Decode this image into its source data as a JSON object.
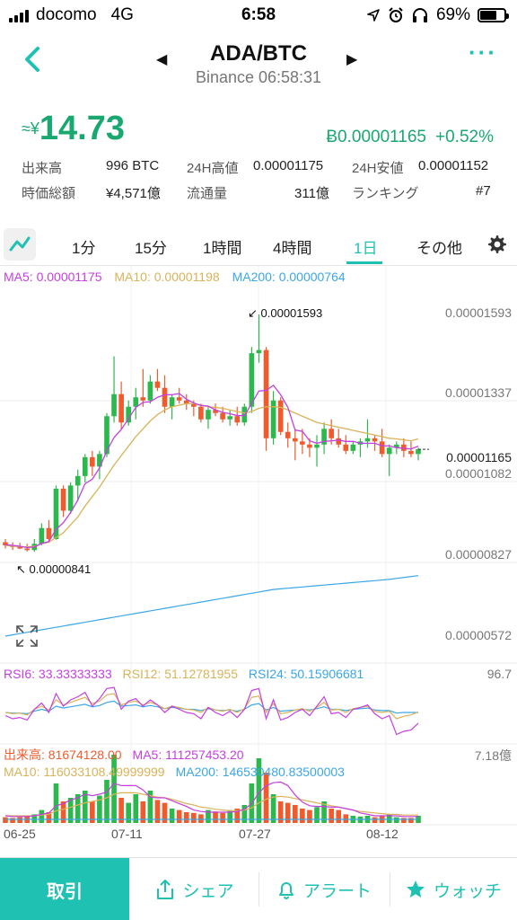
{
  "status_bar": {
    "carrier": "docomo",
    "network": "4G",
    "time": "6:58",
    "battery": "69%",
    "battery_level": 0.69
  },
  "header": {
    "title": "ADA/BTC",
    "subtitle": "Binance 06:58:31"
  },
  "price": {
    "prefix": "≈¥",
    "value": "14.73",
    "btc_value": "Ƀ0.00001165",
    "change": "+0.52%"
  },
  "stats": [
    {
      "label": "出来高",
      "value": "996 BTC"
    },
    {
      "label": "24H高値",
      "value": "0.00001175"
    },
    {
      "label": "24H安値",
      "value": "0.00001152"
    },
    {
      "label": "時価総額",
      "value": "¥4,571億"
    },
    {
      "label": "流通量",
      "value": "311億"
    },
    {
      "label": "ランキング",
      "value": "#7"
    }
  ],
  "tabs": [
    "1分",
    "15分",
    "1時間",
    "4時間",
    "1日",
    "その他"
  ],
  "active_tab": "1日",
  "colors": {
    "accent": "#1fc1b3",
    "up": "#1aa871",
    "candle_up": "#2db84d",
    "candle_down": "#ef5b2d",
    "ma5": "#c53fe0",
    "ma10": "#d9b35a",
    "ma200": "#3ba7e6"
  },
  "indicators": {
    "ma5": "MA5: 0.00001175",
    "ma10": "MA10: 0.00001198",
    "ma200": "MA200: 0.00000764",
    "rsi6": "RSI6: 33.33333333",
    "rsi12": "RSI12: 51.12781955",
    "rsi24": "RSI24: 50.15906681",
    "rsi_max": "96.7",
    "vol": "出来高: 81674128.00",
    "vol_ma5": "MA5: 111257453.20",
    "vol_ma10": "MA10: 116033108.49999999",
    "vol_ma200": "MA200: 146530480.83500003",
    "vol_max": "7.18億"
  },
  "chart_data": {
    "type": "candlestick",
    "y_ticks": [
      "0.00001593",
      "0.00001337",
      "0.00001082",
      "0.00000827",
      "0.00000572"
    ],
    "current_price": "0.00001165",
    "annotations": {
      "high": "0.00001593",
      "low": "0.00000841"
    },
    "x_ticks": [
      "06-25",
      "07-11",
      "07-27",
      "08-12"
    ],
    "ohlc": [
      [
        8.7e-06,
        8.8e-06,
        8.5e-06,
        8.6e-06
      ],
      [
        8.6e-06,
        8.7e-06,
        8.45e-06,
        8.55e-06
      ],
      [
        8.55e-06,
        8.68e-06,
        8.48e-06,
        8.5e-06
      ],
      [
        8.5e-06,
        8.65e-06,
        8.41e-06,
        8.45e-06
      ],
      [
        8.45e-06,
        8.8e-06,
        8.4e-06,
        8.65e-06
      ],
      [
        8.65e-06,
        9.3e-06,
        8.6e-06,
        9.15e-06
      ],
      [
        9.15e-06,
        9.4e-06,
        8.7e-06,
        8.8e-06
      ],
      [
        8.8e-06,
        1.05e-05,
        8.78e-06,
        1.04e-05
      ],
      [
        1.04e-05,
        1.05e-05,
        9.5e-06,
        9.7e-06
      ],
      [
        9.7e-06,
        1.06e-05,
        9.6e-06,
        1.05e-05
      ],
      [
        1.05e-05,
        1.1e-05,
        1e-05,
        1.08e-05
      ],
      [
        1.08e-05,
        1.15e-05,
        1.06e-05,
        1.14e-05
      ],
      [
        1.14e-05,
        1.16e-05,
        1.08e-05,
        1.11e-05
      ],
      [
        1.11e-05,
        1.16e-05,
        1.07e-05,
        1.15e-05
      ],
      [
        1.15e-05,
        1.28e-05,
        1.14e-05,
        1.27e-05
      ],
      [
        1.27e-05,
        1.46e-05,
        1.25e-05,
        1.34e-05
      ],
      [
        1.34e-05,
        1.38e-05,
        1.23e-05,
        1.25e-05
      ],
      [
        1.25e-05,
        1.32e-05,
        1.24e-05,
        1.3e-05
      ],
      [
        1.3e-05,
        1.36e-05,
        1.26e-05,
        1.33e-05
      ],
      [
        1.33e-05,
        1.42e-05,
        1.3e-05,
        1.32e-05
      ],
      [
        1.32e-05,
        1.4e-05,
        1.31e-05,
        1.38e-05
      ],
      [
        1.38e-05,
        1.42e-05,
        1.35e-05,
        1.36e-05
      ],
      [
        1.36e-05,
        1.4e-05,
        1.28e-05,
        1.3e-05
      ],
      [
        1.3e-05,
        1.34e-05,
        1.26e-05,
        1.33e-05
      ],
      [
        1.33e-05,
        1.36e-05,
        1.31e-05,
        1.32e-05
      ],
      [
        1.32e-05,
        1.34e-05,
        1.29e-05,
        1.31e-05
      ],
      [
        1.31e-05,
        1.32e-05,
        1.27e-05,
        1.3e-05
      ],
      [
        1.3e-05,
        1.31e-05,
        1.25e-05,
        1.26e-05
      ],
      [
        1.26e-05,
        1.3e-05,
        1.23e-05,
        1.29e-05
      ],
      [
        1.29e-05,
        1.31e-05,
        1.27e-05,
        1.28e-05
      ],
      [
        1.28e-05,
        1.3e-05,
        1.25e-05,
        1.26e-05
      ],
      [
        1.26e-05,
        1.29e-05,
        1.24e-05,
        1.27e-05
      ],
      [
        1.27e-05,
        1.3e-05,
        1.24e-05,
        1.25e-05
      ],
      [
        1.25e-05,
        1.31e-05,
        1.24e-05,
        1.3e-05
      ],
      [
        1.3e-05,
        1.49e-05,
        1.28e-05,
        1.47e-05
      ],
      [
        1.47e-05,
        1.593e-05,
        1.44e-05,
        1.48e-05
      ],
      [
        1.48e-05,
        1.49e-05,
        1.16e-05,
        1.2e-05
      ],
      [
        1.2e-05,
        1.35e-05,
        1.18e-05,
        1.32e-05
      ],
      [
        1.32e-05,
        1.33e-05,
        1.21e-05,
        1.22e-05
      ],
      [
        1.22e-05,
        1.25e-05,
        1.17e-05,
        1.2e-05
      ],
      [
        1.2e-05,
        1.23e-05,
        1.13e-05,
        1.19e-05
      ],
      [
        1.19e-05,
        1.23e-05,
        1.15e-05,
        1.18e-05
      ],
      [
        1.18e-05,
        1.2e-05,
        1.14e-05,
        1.17e-05
      ],
      [
        1.17e-05,
        1.21e-05,
        1.11e-05,
        1.18e-05
      ],
      [
        1.18e-05,
        1.25e-05,
        1.15e-05,
        1.23e-05
      ],
      [
        1.23e-05,
        1.26e-05,
        1.18e-05,
        1.2e-05
      ],
      [
        1.2e-05,
        1.23e-05,
        1.17e-05,
        1.18e-05
      ],
      [
        1.18e-05,
        1.21e-05,
        1.15e-05,
        1.16e-05
      ],
      [
        1.16e-05,
        1.19e-05,
        1.15e-05,
        1.18e-05
      ],
      [
        1.18e-05,
        1.2e-05,
        1.14e-05,
        1.19e-05
      ],
      [
        1.19e-05,
        1.26e-05,
        1.17e-05,
        1.2e-05
      ],
      [
        1.2e-05,
        1.21e-05,
        1.16e-05,
        1.19e-05
      ],
      [
        1.19e-05,
        1.23e-05,
        1.14e-05,
        1.15e-05
      ],
      [
        1.15e-05,
        1.18e-05,
        1.08e-05,
        1.17e-05
      ],
      [
        1.17e-05,
        1.19e-05,
        1.15e-05,
        1.18e-05
      ],
      [
        1.18e-05,
        1.2e-05,
        1.14e-05,
        1.16e-05
      ],
      [
        1.16e-05,
        1.19e-05,
        1.14e-05,
        1.15e-05
      ],
      [
        1.15e-05,
        1.17e-05,
        1.13e-05,
        1.165e-05
      ]
    ],
    "ma10": [
      8.6e-06,
      8.58e-06,
      8.56e-06,
      8.55e-06,
      8.57e-06,
      8.65e-06,
      8.7e-06,
      8.85e-06,
      9e-06,
      9.25e-06,
      9.5e-06,
      9.85e-06,
      1.015e-05,
      1.045e-05,
      1.08e-05,
      1.115e-05,
      1.145e-05,
      1.175e-05,
      1.205e-05,
      1.23e-05,
      1.255e-05,
      1.275e-05,
      1.29e-05,
      1.3e-05,
      1.305e-05,
      1.31e-05,
      1.31e-05,
      1.305e-05,
      1.3e-05,
      1.298e-05,
      1.295e-05,
      1.29e-05,
      1.285e-05,
      1.28e-05,
      1.285e-05,
      1.295e-05,
      1.3e-05,
      1.3e-05,
      1.298e-05,
      1.29e-05,
      1.28e-05,
      1.27e-05,
      1.26e-05,
      1.25e-05,
      1.245e-05,
      1.24e-05,
      1.235e-05,
      1.23e-05,
      1.225e-05,
      1.22e-05,
      1.215e-05,
      1.21e-05,
      1.205e-05,
      1.2e-05,
      1.198e-05,
      1.195e-05,
      1.192e-05,
      1.198e-05
    ],
    "ma5": [
      8.62e-06,
      8.6e-06,
      8.57e-06,
      8.53e-06,
      8.55e-06,
      8.66e-06,
      8.72e-06,
      9.11e-06,
      9.32e-06,
      9.64e-06,
      1.004e-05,
      1.056e-05,
      1.07e-05,
      1.106e-05,
      1.16e-05,
      1.202e-05,
      1.228e-05,
      1.262e-05,
      1.298e-05,
      1.314e-05,
      1.316e-05,
      1.33e-05,
      1.338e-05,
      1.338e-05,
      1.342e-05,
      1.324e-05,
      1.312e-05,
      1.304e-05,
      1.302e-05,
      1.29e-05,
      1.282e-05,
      1.278e-05,
      1.272e-05,
      1.272e-05,
      1.31e-05,
      1.35e-05,
      1.352e-05,
      1.368e-05,
      1.338e-05,
      1.298e-05,
      1.226e-05,
      1.222e-05,
      1.192e-05,
      1.184e-05,
      1.19e-05,
      1.192e-05,
      1.194e-05,
      1.19e-05,
      1.19e-05,
      1.184e-05,
      1.184e-05,
      1.184e-05,
      1.176e-05,
      1.176e-05,
      1.17e-05,
      1.168e-05,
      1.166e-05,
      1.175e-05
    ],
    "ma200": [
      5.72e-06,
      5.76e-06,
      5.8e-06,
      5.84e-06,
      5.88e-06,
      5.92e-06,
      5.96e-06,
      6e-06,
      6.04e-06,
      6.08e-06,
      6.12e-06,
      6.16e-06,
      6.2e-06,
      6.24e-06,
      6.28e-06,
      6.32e-06,
      6.36e-06,
      6.4e-06,
      6.44e-06,
      6.48e-06,
      6.52e-06,
      6.56e-06,
      6.6e-06,
      6.64e-06,
      6.68e-06,
      6.72e-06,
      6.76e-06,
      6.8e-06,
      6.84e-06,
      6.88e-06,
      6.92e-06,
      6.96e-06,
      7e-06,
      7.04e-06,
      7.08e-06,
      7.12e-06,
      7.16e-06,
      7.2e-06,
      7.22e-06,
      7.24e-06,
      7.26e-06,
      7.28e-06,
      7.3e-06,
      7.32e-06,
      7.34e-06,
      7.36e-06,
      7.38e-06,
      7.4e-06,
      7.42e-06,
      7.44e-06,
      7.46e-06,
      7.48e-06,
      7.5e-06,
      7.52e-06,
      7.55e-06,
      7.58e-06,
      7.61e-06,
      7.64e-06
    ],
    "rsi6": [
      45,
      40,
      42,
      38,
      55,
      65,
      50,
      80,
      60,
      70,
      75,
      82,
      60,
      72,
      88,
      90,
      55,
      68,
      72,
      60,
      70,
      62,
      50,
      60,
      55,
      50,
      48,
      40,
      58,
      50,
      45,
      52,
      42,
      55,
      85,
      88,
      40,
      70,
      38,
      42,
      50,
      55,
      45,
      60,
      75,
      48,
      50,
      42,
      55,
      58,
      62,
      48,
      40,
      45,
      15,
      20,
      22,
      33
    ],
    "rsi12": [
      50,
      48,
      49,
      46,
      55,
      60,
      54,
      70,
      62,
      66,
      70,
      74,
      64,
      68,
      78,
      80,
      62,
      66,
      68,
      62,
      66,
      62,
      56,
      60,
      58,
      55,
      54,
      50,
      58,
      54,
      52,
      55,
      50,
      56,
      74,
      76,
      50,
      64,
      48,
      50,
      54,
      56,
      52,
      58,
      66,
      54,
      55,
      50,
      56,
      58,
      60,
      52,
      50,
      52,
      40,
      44,
      46,
      51
    ],
    "rsi24": [
      50,
      49,
      49,
      48,
      52,
      55,
      52,
      60,
      57,
      59,
      61,
      63,
      59,
      61,
      66,
      68,
      60,
      61,
      62,
      59,
      61,
      59,
      56,
      58,
      57,
      55,
      55,
      53,
      56,
      54,
      53,
      54,
      52,
      55,
      62,
      64,
      54,
      58,
      52,
      53,
      54,
      55,
      54,
      56,
      59,
      55,
      55,
      53,
      55,
      56,
      57,
      54,
      53,
      53,
      49,
      50,
      50,
      50
    ],
    "volume": [
      0.08,
      0.07,
      0.08,
      0.09,
      0.12,
      0.18,
      0.15,
      0.55,
      0.3,
      0.35,
      0.4,
      0.45,
      0.3,
      0.38,
      0.6,
      0.95,
      0.35,
      0.28,
      0.4,
      0.3,
      0.45,
      0.32,
      0.28,
      0.2,
      0.18,
      0.15,
      0.14,
      0.12,
      0.18,
      0.16,
      0.14,
      0.18,
      0.2,
      0.25,
      0.55,
      0.9,
      0.7,
      0.4,
      0.3,
      0.28,
      0.25,
      0.2,
      0.18,
      0.22,
      0.3,
      0.2,
      0.18,
      0.12,
      0.1,
      0.09,
      0.1,
      0.08,
      0.1,
      0.12,
      0.08,
      0.07,
      0.07,
      0.1
    ],
    "vol_ma5": [
      0.1,
      0.09,
      0.09,
      0.09,
      0.1,
      0.12,
      0.14,
      0.24,
      0.27,
      0.32,
      0.35,
      0.4,
      0.38,
      0.4,
      0.43,
      0.55,
      0.52,
      0.52,
      0.52,
      0.46,
      0.36,
      0.35,
      0.35,
      0.31,
      0.27,
      0.23,
      0.18,
      0.16,
      0.15,
      0.15,
      0.15,
      0.15,
      0.16,
      0.19,
      0.27,
      0.42,
      0.52,
      0.56,
      0.57,
      0.52,
      0.39,
      0.29,
      0.24,
      0.23,
      0.23,
      0.22,
      0.22,
      0.2,
      0.18,
      0.14,
      0.12,
      0.1,
      0.1,
      0.1,
      0.1,
      0.09,
      0.09,
      0.09
    ],
    "vol_ma10": [
      0.1,
      0.1,
      0.1,
      0.1,
      0.1,
      0.11,
      0.12,
      0.17,
      0.19,
      0.22,
      0.25,
      0.28,
      0.3,
      0.32,
      0.35,
      0.4,
      0.42,
      0.42,
      0.42,
      0.4,
      0.38,
      0.36,
      0.35,
      0.33,
      0.3,
      0.27,
      0.25,
      0.22,
      0.21,
      0.19,
      0.18,
      0.17,
      0.17,
      0.18,
      0.21,
      0.28,
      0.33,
      0.36,
      0.37,
      0.36,
      0.34,
      0.32,
      0.3,
      0.28,
      0.26,
      0.24,
      0.22,
      0.2,
      0.18,
      0.16,
      0.15,
      0.14,
      0.13,
      0.12,
      0.12,
      0.11,
      0.11,
      0.11
    ],
    "vol_ma200": [
      0.05,
      0.05,
      0.05,
      0.05,
      0.05,
      0.05,
      0.05,
      0.05,
      0.05,
      0.05,
      0.05,
      0.05,
      0.05,
      0.05,
      0.05,
      0.05,
      0.05,
      0.05,
      0.05,
      0.05,
      0.05,
      0.05,
      0.05,
      0.05,
      0.05,
      0.05,
      0.05,
      0.05,
      0.05,
      0.05,
      0.05,
      0.05,
      0.05,
      0.05,
      0.05,
      0.05,
      0.05,
      0.05,
      0.05,
      0.05,
      0.05,
      0.05,
      0.05,
      0.05,
      0.05,
      0.05,
      0.05,
      0.05,
      0.05,
      0.05,
      0.05,
      0.05,
      0.05,
      0.05,
      0.05,
      0.05,
      0.05,
      0.05
    ]
  },
  "bottom_bar": {
    "trade": "取引",
    "share": "シェア",
    "alert": "アラート",
    "watch": "ウォッチ"
  }
}
